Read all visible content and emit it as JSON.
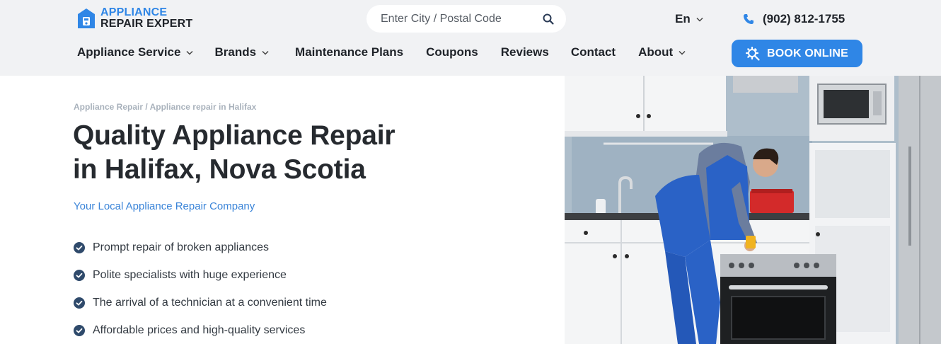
{
  "brand": {
    "line1": "APPLIANCE",
    "line2": "REPAIR EXPERT"
  },
  "search": {
    "placeholder": "Enter City / Postal Code",
    "value": ""
  },
  "language": {
    "selected": "En"
  },
  "phone": {
    "number": "(902) 812-1755"
  },
  "nav": {
    "items": [
      {
        "label": "Appliance Service",
        "dropdown": true
      },
      {
        "label": "Brands",
        "dropdown": true
      },
      {
        "label": "Maintenance Plans",
        "dropdown": false
      },
      {
        "label": "Coupons",
        "dropdown": false
      },
      {
        "label": "Reviews",
        "dropdown": false
      },
      {
        "label": "Contact",
        "dropdown": false
      },
      {
        "label": "About",
        "dropdown": true
      }
    ],
    "book_label": "BOOK ONLINE"
  },
  "breadcrumb": {
    "items": [
      "Appliance Repair",
      "Appliance repair in Halifax"
    ],
    "separator": " / "
  },
  "hero": {
    "title_line1": "Quality Appliance Repair",
    "title_line2": "in Halifax, Nova Scotia",
    "subtitle": "Your Local Appliance Repair Company",
    "features": [
      "Prompt repair of broken appliances",
      "Polite specialists with huge experience",
      "The arrival of a technician at a convenient time",
      "Affordable prices and high-quality services"
    ]
  },
  "colors": {
    "accent": "#2f86e6",
    "header_bg": "#f1f2f4",
    "check": "#2f4a6b",
    "title": "#262a2f"
  }
}
